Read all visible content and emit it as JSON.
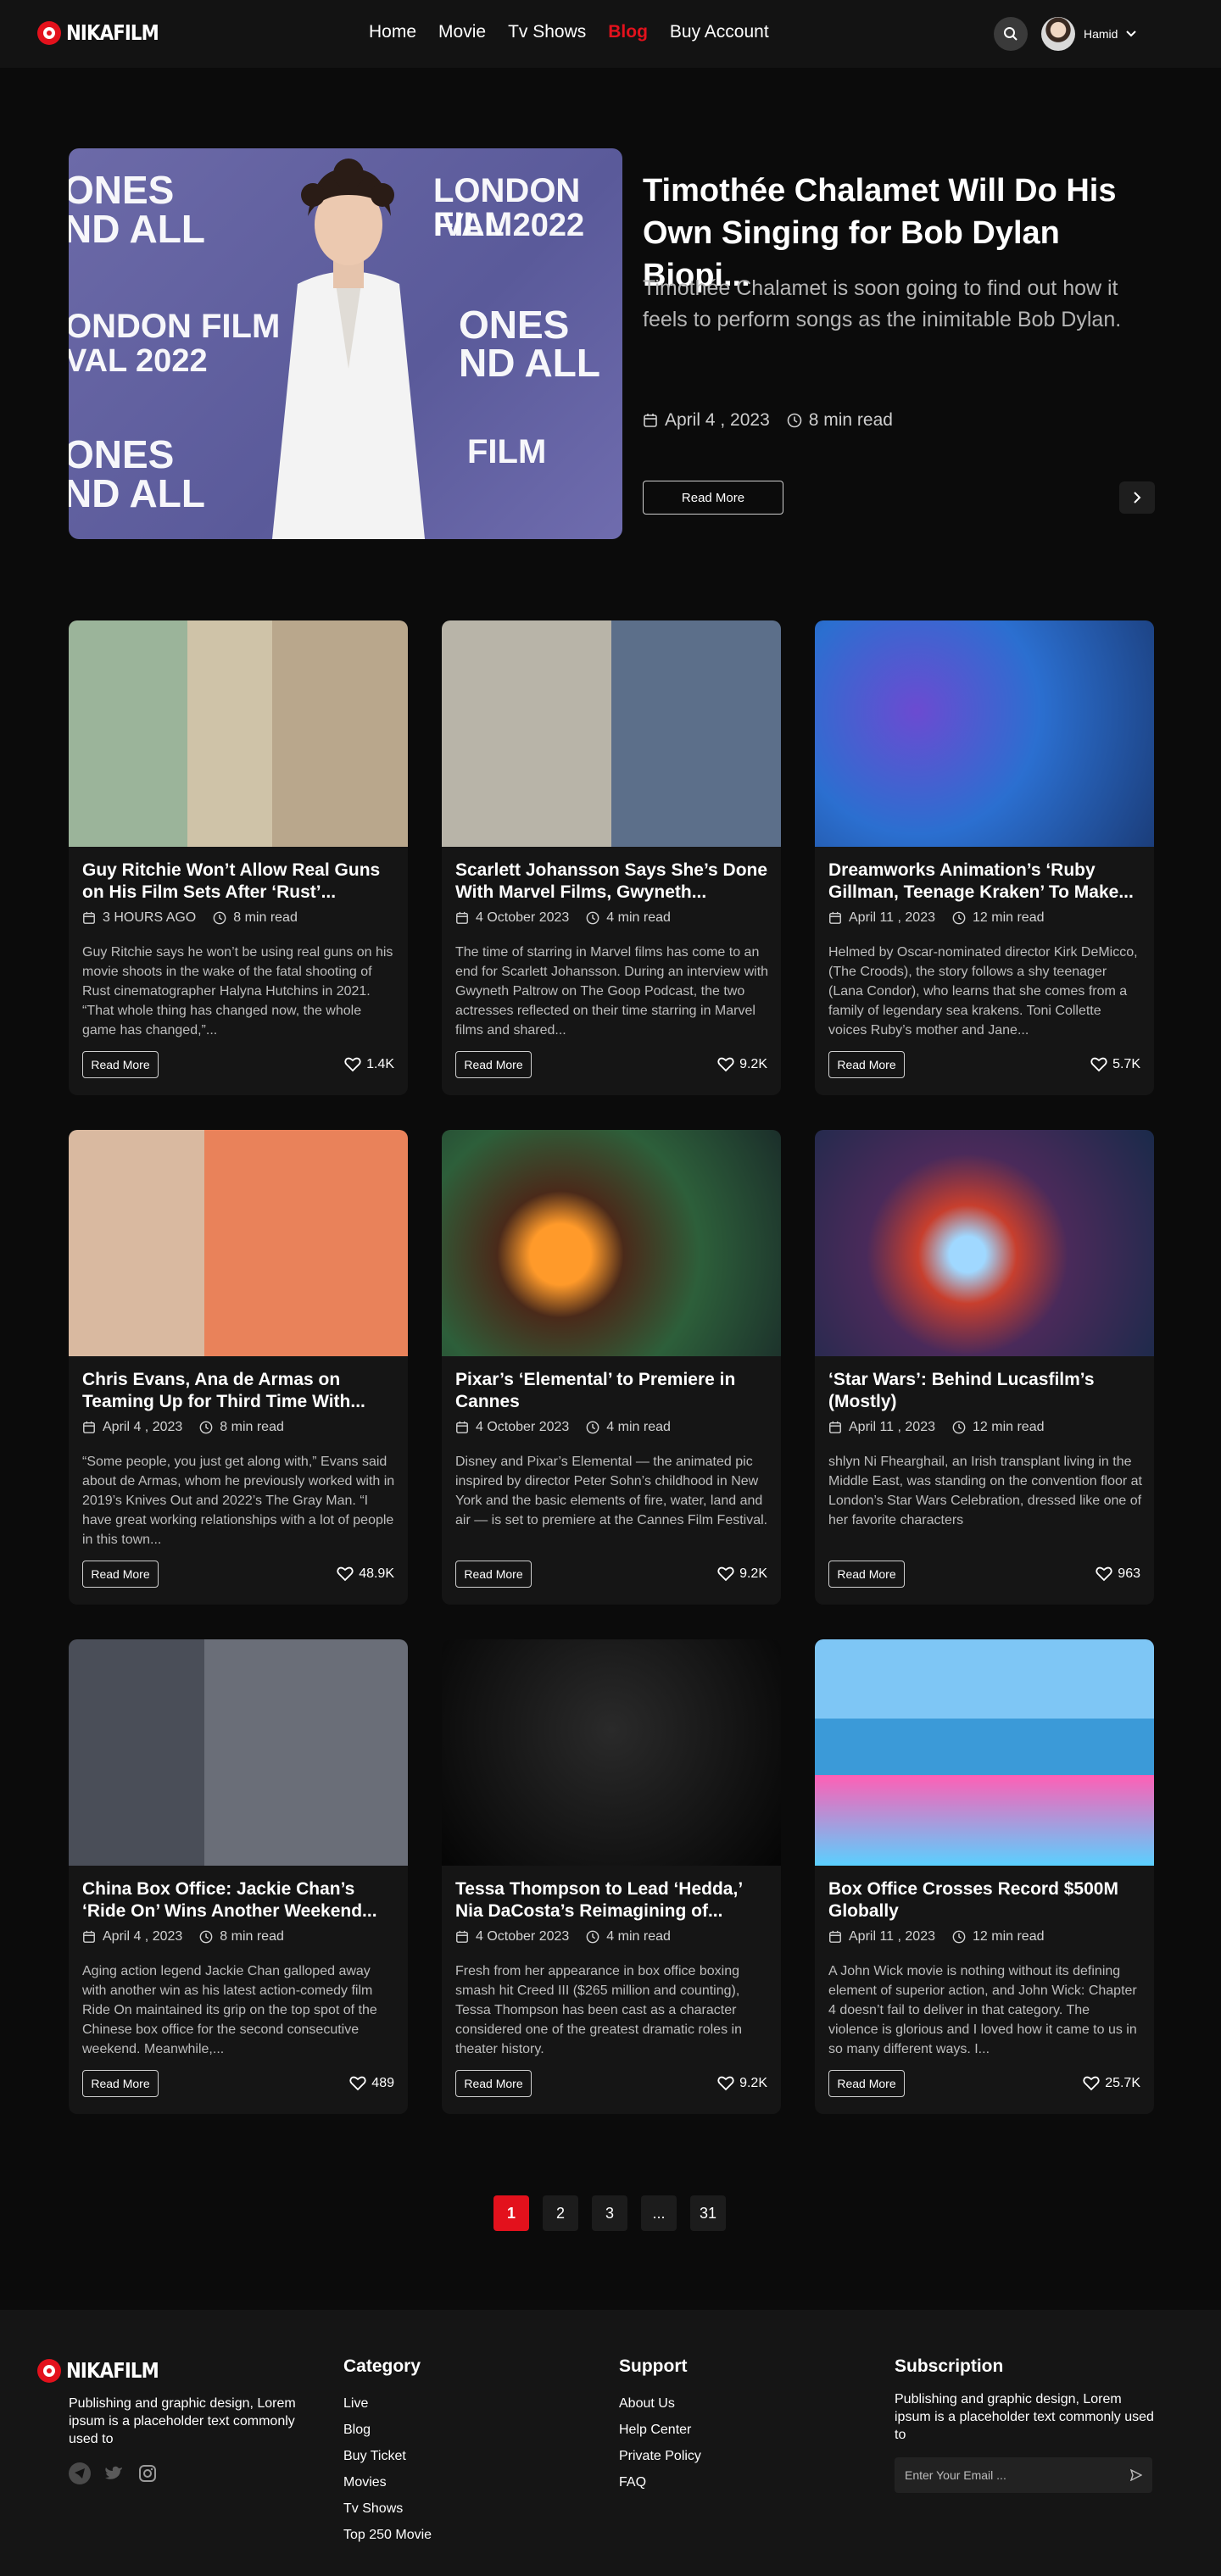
{
  "nav": {
    "logo": "NIKAFILM",
    "items": [
      {
        "label": "Home",
        "active": false
      },
      {
        "label": "Movie",
        "active": false
      },
      {
        "label": "Tv Shows",
        "active": false
      },
      {
        "label": "Blog",
        "active": true
      },
      {
        "label": "Buy Account",
        "active": false
      }
    ],
    "user_name": "Hamid"
  },
  "hero": {
    "title": "Timothée Chalamet Will Do His Own Singing for Bob Dylan Biopi...",
    "description": "Timothée Chalamet is soon going to find out how it feels to perform songs as the inimitable Bob Dylan.",
    "date": "April 4 , 2023",
    "read_time": "8 min read",
    "read_more": "Read More",
    "backdrop_text": [
      "ONES",
      "ND ALL",
      "LONDON FILM",
      "IVAL 2022",
      "ONDON FILM",
      "VAL 2022",
      "ONES",
      "ND ALL",
      "ONES",
      "ND ALL",
      "FILM"
    ]
  },
  "cards": [
    {
      "title": "Guy Ritchie Won’t Allow Real Guns on His Film Sets After ‘Rust’...",
      "date": "3 HOURS AGO",
      "read_time": "8 min read",
      "desc": "Guy Ritchie says he won’t be using real guns on his movie shoots in the wake of the fatal shooting of Rust cinematographer Halyna Hutchins in 2021. “That whole thing has changed now, the whole game has changed,”...",
      "read_more": "Read More",
      "likes": "1.4K"
    },
    {
      "title": "Scarlett Johansson Says She’s Done With Marvel Films, Gwyneth...",
      "date": "4 October 2023",
      "read_time": "4 min read",
      "desc": "The time of starring in Marvel films has come to an end for Scarlett Johansson. During an interview with Gwyneth Paltrow on The Goop Podcast, the two actresses reflected on their time starring in Marvel films and shared...",
      "read_more": "Read More",
      "likes": "9.2K"
    },
    {
      "title": "Dreamworks Animation’s ‘Ruby Gillman, Teenage Kraken’ To Make...",
      "date": "April 11 , 2023",
      "read_time": "12 min read",
      "desc": "Helmed by Oscar-nominated director Kirk DeMicco,(The Croods), the story follows a shy teenager (Lana Condor), who learns that she comes from a family of legendary sea krakens. Toni Collette voices Ruby’s mother and Jane...",
      "read_more": "Read More",
      "likes": "5.7K"
    },
    {
      "title": "Chris Evans, Ana de Armas on Teaming Up for Third Time With...",
      "date": "April 4 , 2023",
      "read_time": "8 min read",
      "desc": "“Some people, you just get along with,” Evans said about de Armas, whom he previously worked with in 2019’s Knives Out and 2022’s The Gray Man. “I have great working relationships with a lot of people in this town...",
      "read_more": "Read More",
      "likes": "48.9K"
    },
    {
      "title": "Pixar’s ‘Elemental’ to Premiere in Cannes",
      "date": "4 October 2023",
      "read_time": "4 min read",
      "desc": "Disney and Pixar’s Elemental — the animated pic inspired by director Peter Sohn’s childhood in New York and the basic elements of fire, water, land and air — is set to premiere at the Cannes Film Festival.",
      "read_more": "Read More",
      "likes": "9.2K"
    },
    {
      "title": "‘Star Wars’: Behind Lucasfilm’s (Mostly)",
      "date": "April 11 , 2023",
      "read_time": "12 min read",
      "desc": "shlyn Ni Fhearghail, an Irish transplant living in the Middle East, was standing on the convention floor at London’s Star Wars Celebration, dressed like one of her favorite characters",
      "read_more": "Read More",
      "likes": "963"
    },
    {
      "title": "China Box Office: Jackie Chan’s ‘Ride On’ Wins Another Weekend...",
      "date": "April 4 , 2023",
      "read_time": "8 min read",
      "desc": "Aging action legend Jackie Chan galloped away with another win as his latest action-comedy film Ride On maintained its grip on the top spot of the Chinese box office for the second consecutive weekend. Meanwhile,...",
      "read_more": "Read More",
      "likes": "489"
    },
    {
      "title": "Tessa Thompson to Lead ‘Hedda,’ Nia DaCosta’s Reimagining of...",
      "date": "4 October 2023",
      "read_time": "4 min read",
      "desc": "Fresh from her appearance in box office boxing smash hit Creed III ($265 million and counting), Tessa Thompson has been cast as a character considered one of the greatest dramatic roles in theater history.",
      "read_more": "Read More",
      "likes": "9.2K"
    },
    {
      "title": "Box Office  Crosses Record $500M Globally",
      "date": "April 11 , 2023",
      "read_time": "12 min read",
      "desc": "A John Wick movie is nothing without its defining element of superior action, and John Wick: Chapter 4 doesn’t fail to deliver in that category. The violence is glorious and I loved how it came to us in so many different ways. I...",
      "read_more": "Read More",
      "likes": "25.7K"
    }
  ],
  "pagination": [
    "1",
    "2",
    "3",
    "...",
    "31"
  ],
  "footer": {
    "logo": "NIKAFILM",
    "about": "Publishing and graphic design, Lorem ipsum is a placeholder text commonly used to",
    "category_title": "Category",
    "category_items": [
      "Live",
      "Blog",
      "Buy Ticket",
      "Movies",
      "Tv Shows",
      "Top 250 Movie"
    ],
    "support_title": "Support",
    "support_items": [
      "About Us",
      "Help Center",
      "Private Policy",
      "FAQ"
    ],
    "subscription_title": "Subscription",
    "subscription_text": "Publishing and graphic design, Lorem ipsum is a placeholder text commonly used to",
    "email_placeholder": "Enter Your Email ..."
  },
  "colors": {
    "accent": "#e3111c",
    "background": "#0b0b0b",
    "card": "#151515"
  }
}
